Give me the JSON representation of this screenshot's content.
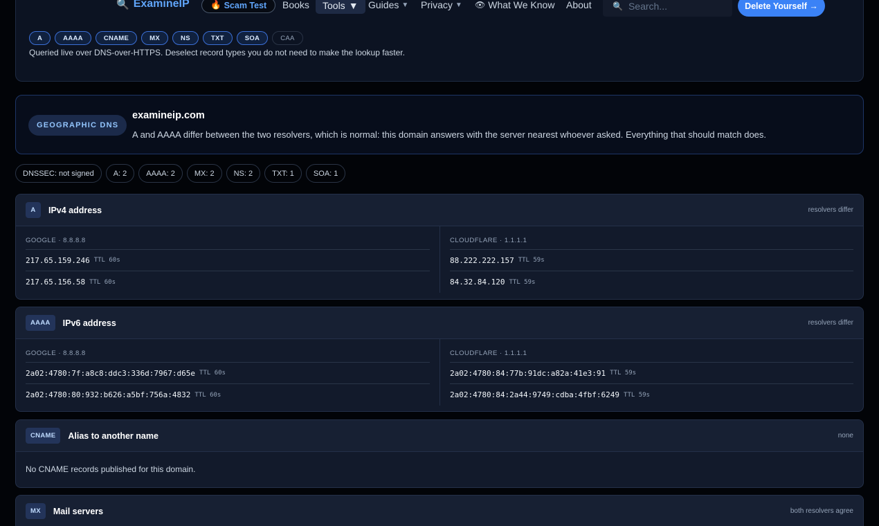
{
  "nav": {
    "brand": "ExamineIP",
    "scam_test": "Scam Test",
    "links": [
      "Books",
      "Tools",
      "Guides",
      "Privacy",
      "What We Know",
      "About"
    ],
    "search_placeholder": "Search...",
    "delete_button": "Delete Yourself →"
  },
  "query": {
    "record_types": [
      "A",
      "AAAA",
      "CNAME",
      "MX",
      "NS",
      "TXT",
      "SOA",
      "CAA"
    ],
    "selected": [
      "A",
      "AAAA",
      "CNAME",
      "MX",
      "NS",
      "TXT",
      "SOA"
    ],
    "note": "Queried live over DNS-over-HTTPS. Deselect record types you do not need to make the lookup faster."
  },
  "geo": {
    "badge": "GEOGRAPHIC DNS",
    "domain": "examineip.com",
    "description": "A and AAAA differ between the two resolvers, which is normal: this domain answers with the server nearest whoever asked. Everything that should match does."
  },
  "stats": [
    "DNSSEC: not signed",
    "A: 2",
    "AAAA: 2",
    "MX: 2",
    "NS: 2",
    "TXT: 1",
    "SOA: 1"
  ],
  "records": {
    "a": {
      "type": "A",
      "title": "IPv4 address",
      "status": "resolvers differ",
      "google": {
        "label": "GOOGLE · 8.8.8.8",
        "rows": [
          {
            "value": "217.65.159.246",
            "ttl": "TTL 60s"
          },
          {
            "value": "217.65.156.58",
            "ttl": "TTL 60s"
          }
        ]
      },
      "cloudflare": {
        "label": "CLOUDFLARE · 1.1.1.1",
        "rows": [
          {
            "value": "88.222.222.157",
            "ttl": "TTL 59s"
          },
          {
            "value": "84.32.84.120",
            "ttl": "TTL 59s"
          }
        ]
      }
    },
    "aaaa": {
      "type": "AAAA",
      "title": "IPv6 address",
      "status": "resolvers differ",
      "google": {
        "label": "GOOGLE · 8.8.8.8",
        "rows": [
          {
            "value": "2a02:4780:7f:a8c8:ddc3:336d:7967:d65e",
            "ttl": "TTL 60s"
          },
          {
            "value": "2a02:4780:80:932:b626:a5bf:756a:4832",
            "ttl": "TTL 60s"
          }
        ]
      },
      "cloudflare": {
        "label": "CLOUDFLARE · 1.1.1.1",
        "rows": [
          {
            "value": "2a02:4780:84:77b:91dc:a82a:41e3:91",
            "ttl": "TTL 59s"
          },
          {
            "value": "2a02:4780:84:2a44:9749:cdba:4fbf:6249",
            "ttl": "TTL 59s"
          }
        ]
      }
    },
    "cname": {
      "type": "CNAME",
      "title": "Alias to another name",
      "status": "none",
      "empty": "No CNAME records published for this domain."
    },
    "mx": {
      "type": "MX",
      "title": "Mail servers",
      "status": "both resolvers agree"
    }
  }
}
